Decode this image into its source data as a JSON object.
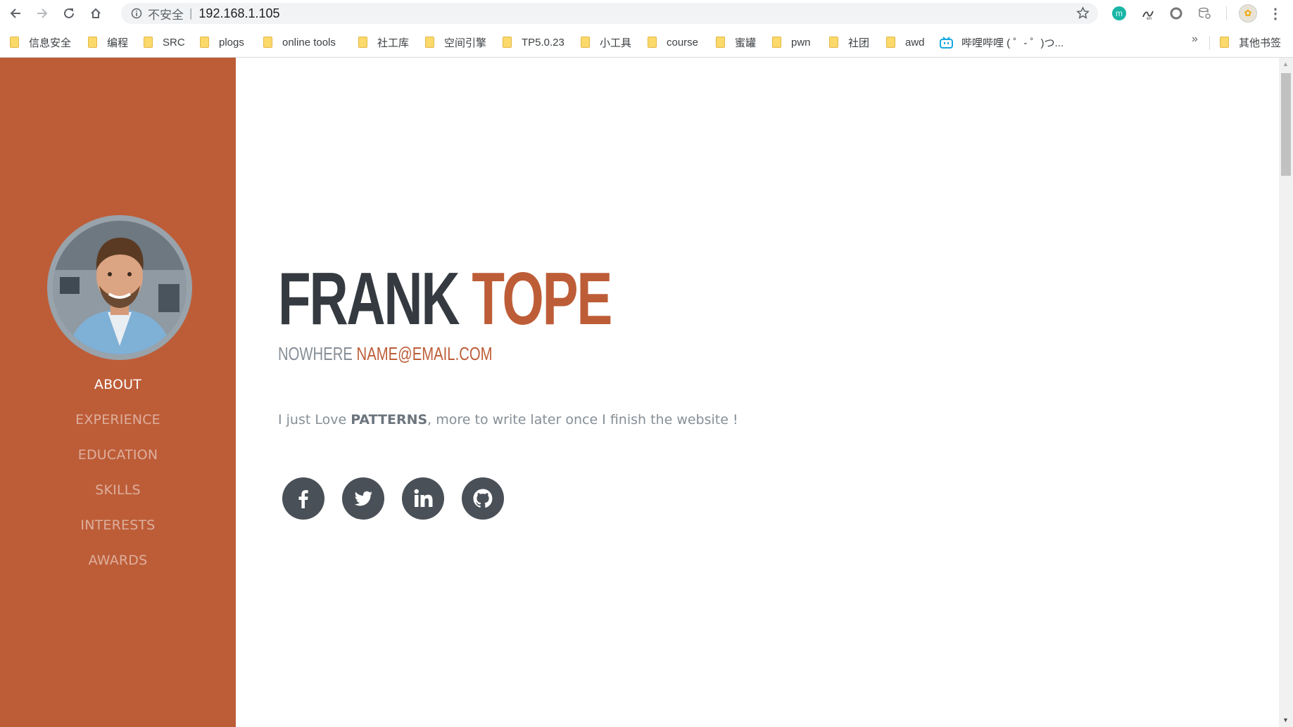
{
  "browser": {
    "security_label": "不安全",
    "separator": "|",
    "url": "192.168.1.105",
    "bookmarks": [
      "信息安全",
      "编程",
      "SRC",
      "plogs",
      "online tools",
      "社工库",
      "空间引擎",
      "TP5.0.23",
      "小工具",
      "course",
      "蜜罐",
      "pwn",
      "社团",
      "awd",
      "哔哩哔哩 ( ゜- ゜)つ..."
    ],
    "bookmarks_overflow": "»",
    "other_bookmarks": "其他书签",
    "extension_m_letter": "m"
  },
  "profile": {
    "first_name": "FRANK",
    "last_name": "TOPE",
    "location": "NOWHERE",
    "email": "NAME@EMAIL.COM",
    "about_prefix": "I just Love ",
    "about_bold": "PATTERNS",
    "about_suffix": ", more to write later once I finish the website !"
  },
  "sidebar": {
    "nav": [
      "ABOUT",
      "EXPERIENCE",
      "EDUCATION",
      "SKILLS",
      "INTERESTS",
      "AWARDS"
    ],
    "active": "ABOUT"
  },
  "social": [
    "facebook-icon",
    "twitter-icon",
    "linkedin-icon",
    "github-icon"
  ],
  "colors": {
    "primary": "#bd5d38",
    "dark": "#343a40",
    "muted": "#868e96",
    "social_bg": "#495057"
  }
}
